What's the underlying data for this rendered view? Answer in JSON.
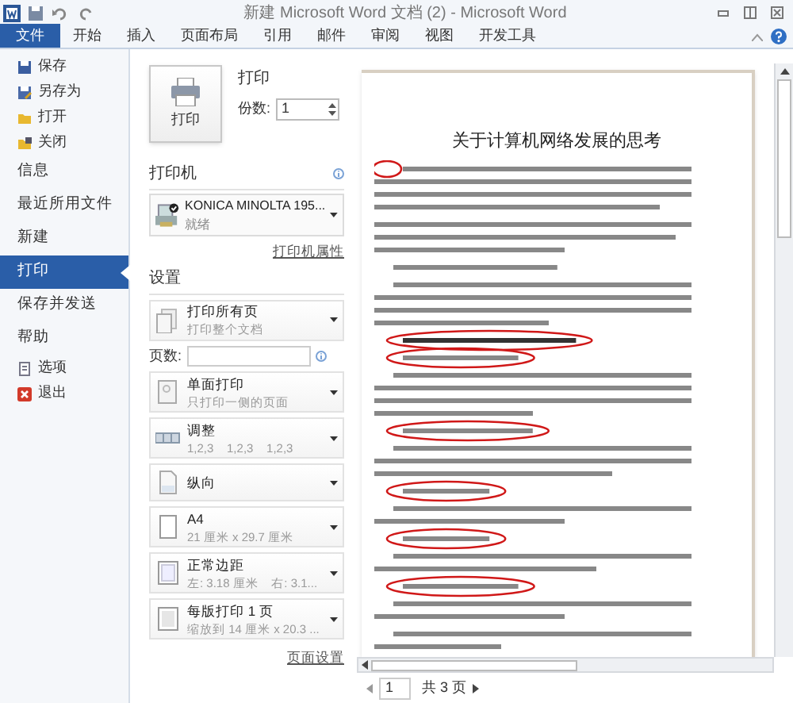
{
  "window": {
    "title": "新建 Microsoft Word 文档 (2) - Microsoft Word"
  },
  "ribbon_tabs": [
    {
      "label": "文件",
      "selected": true
    },
    {
      "label": "开始",
      "selected": false
    },
    {
      "label": "插入",
      "selected": false
    },
    {
      "label": "页面布局",
      "selected": false
    },
    {
      "label": "引用",
      "selected": false
    },
    {
      "label": "邮件",
      "selected": false
    },
    {
      "label": "审阅",
      "selected": false
    },
    {
      "label": "视图",
      "selected": false
    },
    {
      "label": "开发工具",
      "selected": false
    }
  ],
  "sidebar": {
    "items": [
      {
        "kind": "command",
        "label": "保存",
        "selected": false
      },
      {
        "kind": "command",
        "label": "另存为",
        "selected": false
      },
      {
        "kind": "command",
        "label": "打开",
        "selected": false
      },
      {
        "kind": "command",
        "label": "关闭",
        "selected": false
      },
      {
        "kind": "page",
        "label": "信息",
        "selected": false
      },
      {
        "kind": "page",
        "label": "最近所用文件",
        "selected": false
      },
      {
        "kind": "page",
        "label": "新建",
        "selected": false
      },
      {
        "kind": "page",
        "label": "打印",
        "selected": true
      },
      {
        "kind": "page",
        "label": "保存并发送",
        "selected": false
      },
      {
        "kind": "page",
        "label": "帮助",
        "selected": false
      },
      {
        "kind": "command",
        "label": "选项",
        "selected": false
      },
      {
        "kind": "command",
        "label": "退出",
        "selected": false
      }
    ]
  },
  "print": {
    "button": "打印",
    "heading": "打印",
    "copies_label": "份数:",
    "copies": "1"
  },
  "printer": {
    "heading": "打印机",
    "name": "KONICA MINOLTA 195...",
    "status": "就绪",
    "properties_link": "打印机属性"
  },
  "settings": {
    "heading": "设置",
    "pages_label": "页数:",
    "page_setup_link": "页面设置",
    "options": [
      {
        "main": "打印所有页",
        "sub": "打印整个文档"
      },
      {
        "main": "单面打印",
        "sub": "只打印一侧的页面"
      },
      {
        "main": "调整",
        "sub": "1,2,3    1,2,3    1,2,3"
      },
      {
        "main": "纵向"
      },
      {
        "main": "A4",
        "sub": "21 厘米 x 29.7 厘米"
      },
      {
        "main": "正常边距",
        "sub": "左: 3.18 厘米    右: 3.1..."
      },
      {
        "main": "每版打印 1 页",
        "sub": "缩放到 14 厘米 x 20.3 ..."
      }
    ]
  },
  "preview": {
    "document_title": "关于计算机网络发展的思考",
    "page": "1",
    "page_count": "共 3 页"
  }
}
